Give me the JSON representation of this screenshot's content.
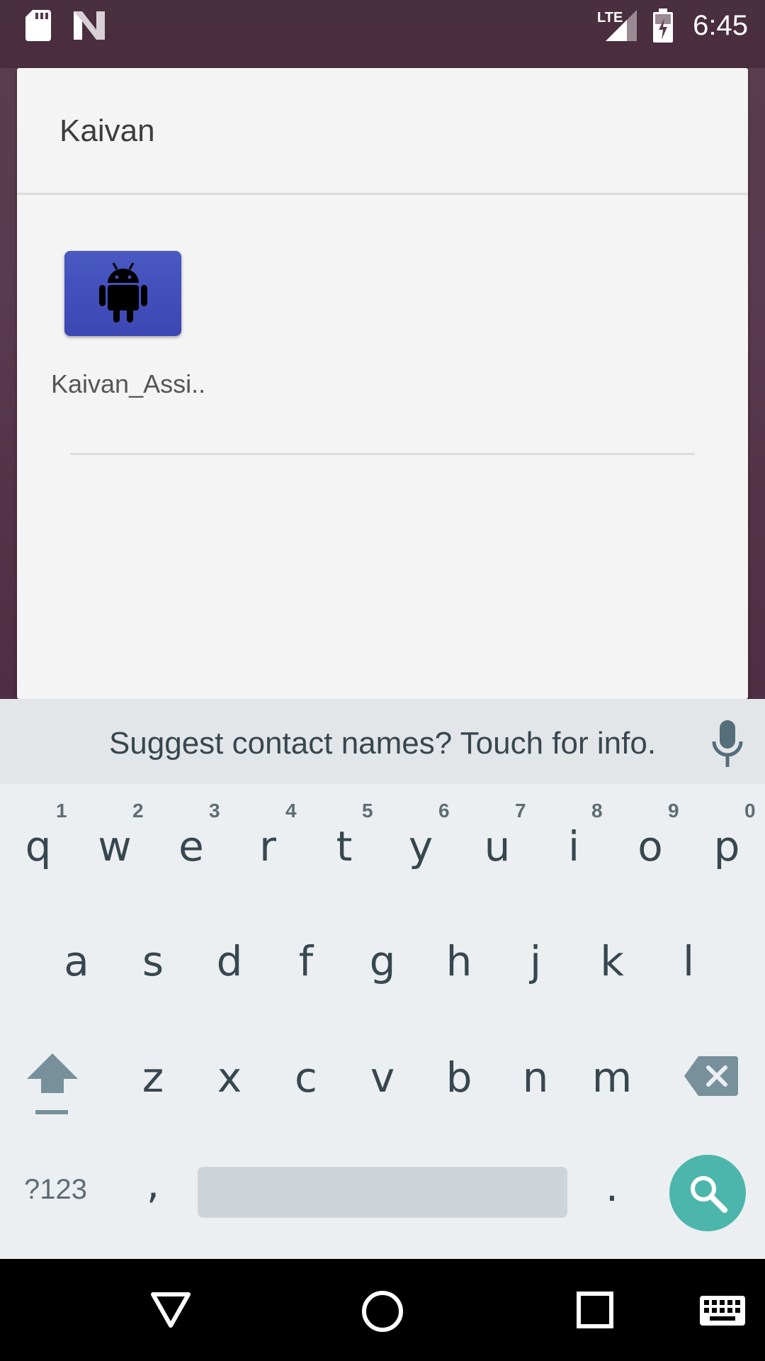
{
  "status_bar": {
    "time": "6:45",
    "network": "LTE",
    "icons": [
      "sd-card-icon",
      "n-logo-icon",
      "signal-icon",
      "battery-charging-icon"
    ]
  },
  "dialog": {
    "title": "Kaivan",
    "apps": [
      {
        "label": "Kaivan_Assi..",
        "icon": "android-icon",
        "tile_color": "#3f51b5"
      }
    ]
  },
  "keyboard": {
    "suggestion": "Suggest contact names? Touch for info.",
    "row1": [
      "q",
      "w",
      "e",
      "r",
      "t",
      "y",
      "u",
      "i",
      "o",
      "p"
    ],
    "row1_hints": [
      "1",
      "2",
      "3",
      "4",
      "5",
      "6",
      "7",
      "8",
      "9",
      "0"
    ],
    "row2": [
      "a",
      "s",
      "d",
      "f",
      "g",
      "h",
      "j",
      "k",
      "l"
    ],
    "row3": [
      "z",
      "x",
      "c",
      "v",
      "b",
      "n",
      "m"
    ],
    "symbols_label": "?123",
    "comma": ",",
    "period": ".",
    "action_color": "#4db6ac"
  },
  "nav_bar": {
    "buttons": [
      "back-icon",
      "home-icon",
      "recents-icon",
      "keyboard-switch-icon"
    ]
  }
}
